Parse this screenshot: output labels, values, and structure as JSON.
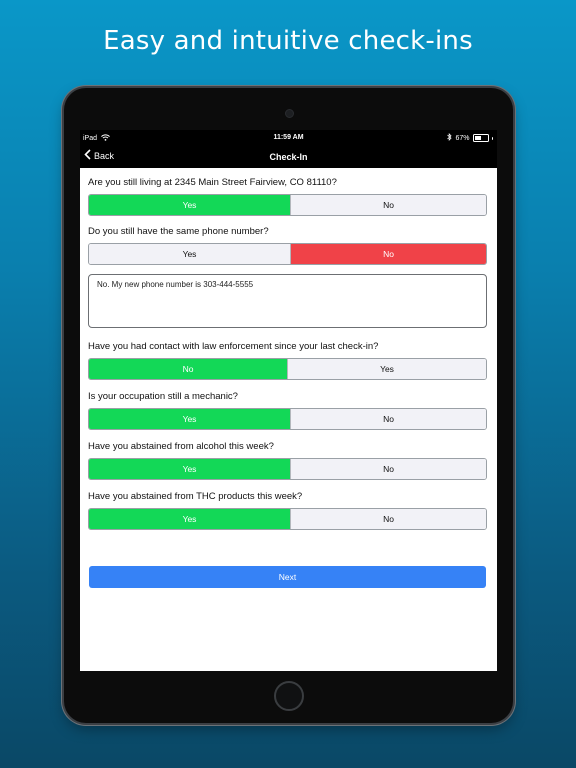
{
  "headline": "Easy and intuitive check-ins",
  "status": {
    "carrier": "iPad",
    "time": "11:59 AM",
    "battery_pct": "67%",
    "battery_level": 0.67
  },
  "nav": {
    "back_label": "Back",
    "title": "Check-In"
  },
  "colors": {
    "selected_yes": "#13d857",
    "selected_no": "#f04248",
    "next_button": "#3682f6"
  },
  "questions": [
    {
      "text": "Are you still living at 2345 Main Street Fairview, CO 81110?",
      "left": "Yes",
      "right": "No",
      "selected": "left"
    },
    {
      "text": "Do you still have the same phone number?",
      "left": "Yes",
      "right": "No",
      "selected": "right",
      "followup": "No. My new phone number is 303-444-5555"
    },
    {
      "text": "Have you had contact with law enforcement since your last check-in?",
      "left": "No",
      "right": "Yes",
      "selected": "left"
    },
    {
      "text": "Is your occupation still a mechanic?",
      "left": "Yes",
      "right": "No",
      "selected": "left"
    },
    {
      "text": "Have you abstained from alcohol this week?",
      "left": "Yes",
      "right": "No",
      "selected": "left"
    },
    {
      "text": "Have you abstained from THC products this week?",
      "left": "Yes",
      "right": "No",
      "selected": "left"
    }
  ],
  "next_label": "Next"
}
